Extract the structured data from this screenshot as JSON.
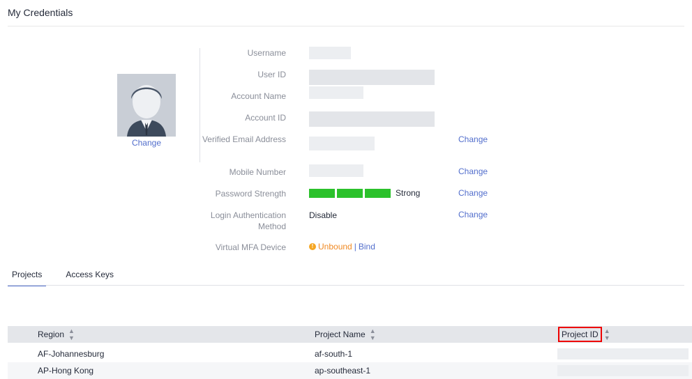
{
  "page": {
    "title": "My Credentials"
  },
  "profile": {
    "avatar_change": "Change",
    "labels": {
      "username": "Username",
      "user_id": "User ID",
      "account_name": "Account Name",
      "account_id": "Account ID",
      "verified_email": "Verified Email Address",
      "mobile": "Mobile Number",
      "password_strength": "Password Strength",
      "login_auth": "Login Authentication Method",
      "virtual_mfa": "Virtual MFA Device"
    },
    "change_label": "Change",
    "password_strength_value": "Strong",
    "login_auth_value": "Disable",
    "mfa": {
      "status": "Unbound",
      "separator": "|",
      "action": "Bind"
    }
  },
  "tabs": [
    {
      "label": "Projects",
      "active": true
    },
    {
      "label": "Access Keys",
      "active": false
    }
  ],
  "table": {
    "columns": {
      "region": "Region",
      "project_name": "Project Name",
      "project_id": "Project ID"
    },
    "rows": [
      {
        "region": "AF-Johannesburg",
        "project_name": "af-south-1"
      },
      {
        "region": "AP-Hong Kong",
        "project_name": "ap-southeast-1"
      }
    ]
  },
  "colors": {
    "accent": "#526ecc",
    "strength_bar": "#2bc12b",
    "warning": "#f5a623",
    "highlight_box": "#ee0000"
  }
}
